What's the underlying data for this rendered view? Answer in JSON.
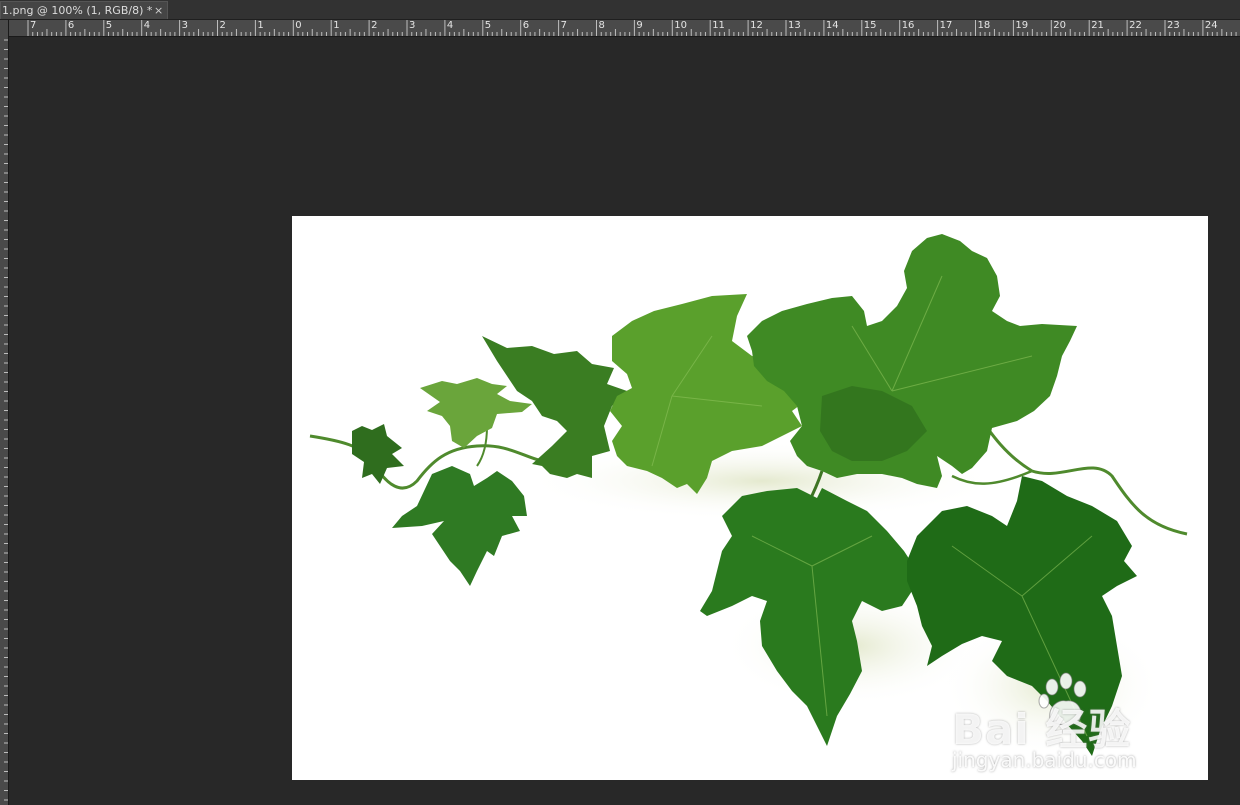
{
  "document_tab": {
    "title": "1.png @ 100% (1, RGB/8) *",
    "close_glyph": "×"
  },
  "ruler": {
    "labels": [
      "7",
      "6",
      "5",
      "4",
      "3",
      "2",
      "1",
      "0",
      "1",
      "2",
      "3",
      "4",
      "5",
      "6",
      "7",
      "8",
      "9",
      "10",
      "11",
      "12",
      "13",
      "14",
      "15",
      "16",
      "17",
      "18",
      "19",
      "20",
      "21",
      "22",
      "23",
      "24"
    ]
  },
  "canvas": {
    "background_color": "#282828",
    "document_background": "#ffffff",
    "image_subject": "green-vine-leaves-image"
  },
  "watermark": {
    "logo_text": "Bai  经验",
    "url": "jingyan.baidu.com",
    "icon": "paw-icon"
  }
}
